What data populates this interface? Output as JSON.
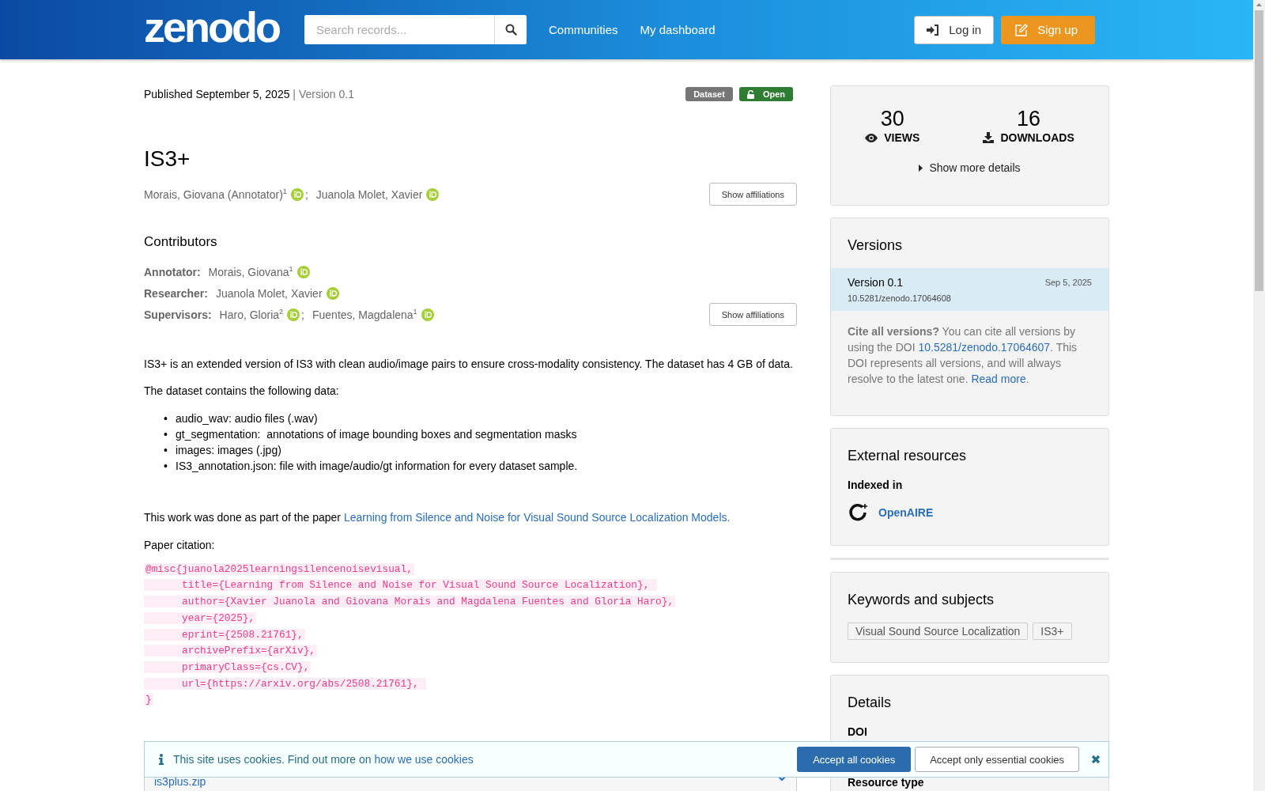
{
  "header": {
    "logo": "zenodo",
    "search": {
      "placeholder": "Search records..."
    },
    "nav": [
      "Communities",
      "My dashboard"
    ],
    "login": "Log in",
    "signup": "Sign up"
  },
  "record": {
    "published": "Published September 5, 2025",
    "separator": "|",
    "version": "Version 0.1",
    "badges": [
      {
        "label": "Dataset",
        "kind": "type"
      },
      {
        "label": "Open",
        "kind": "access"
      }
    ],
    "title": "IS3+",
    "creators": {
      "separator": ";",
      "items": [
        {
          "name": "Morais, Giovana (Annotator)",
          "sup": "1",
          "orcid": true
        },
        {
          "name": "Juanola Molet, Xavier",
          "orcid": true
        }
      ],
      "button": "Show affiliations"
    },
    "contributors": {
      "heading": "Contributors",
      "groups": [
        {
          "role": "Annotator:",
          "people": [
            {
              "name": "Morais, Giovana",
              "sup": "1",
              "orcid": true
            }
          ]
        },
        {
          "role": "Researcher:",
          "people": [
            {
              "name": "Juanola Molet, Xavier",
              "orcid": true
            }
          ]
        },
        {
          "role": "Supervisors:",
          "people": [
            {
              "name": "Haro, Gloria",
              "sup": "2",
              "orcid": true
            },
            {
              "name": "Fuentes, Magdalena",
              "sup": "1",
              "orcid": true
            }
          ]
        }
      ],
      "separator": ";",
      "button": "Show affiliations"
    },
    "description": [
      "IS3+ is an extended version of IS3 with clean audio/image pairs to ensure cross-modality consistency. The dataset has 4 GB of data.",
      "The dataset contains the following data:"
    ],
    "list_marker": "•",
    "list": [
      "audio_wav: audio files (.wav)",
      "gt_segmentation:  annotations of image bounding boxes and segmentation masks",
      "images: images (.jpg)",
      "IS3_annotation.json: file with image/audio/gt information for every dataset sample."
    ],
    "paper": {
      "text": "This work was done as part of the paper ",
      "link": "Learning from Silence and Noise for Visual Sound Source Localization Models."
    },
    "citation_label": "Paper citation:",
    "citation": [
      "@misc{juanola2025learningsilencenoisevisual,",
      "      title={Learning from Silence and Noise for Visual Sound Source Localization}, ",
      "      author={Xavier Juanola and Giovana Morais and Magdalena Fuentes and Gloria Haro},",
      "      year={2025},",
      "      eprint={2508.21761},",
      "      archivePrefix={arXiv},",
      "      primaryClass={cs.CV},",
      "      url={https://arxiv.org/abs/2508.21761}, ",
      "}"
    ],
    "files": [
      {
        "name": "is3plus.zip"
      }
    ]
  },
  "sidebar": {
    "stats": [
      {
        "value": "30",
        "label": "VIEWS",
        "kind": "views"
      },
      {
        "value": "16",
        "label": "DOWNLOADS",
        "kind": "downloads"
      }
    ],
    "more": "Show more details",
    "versions": {
      "title": "Versions",
      "items": [
        {
          "title": "Version 0.1",
          "date": "Sep 5, 2025",
          "doi": "10.5281/zenodo.17064608",
          "selected": true
        }
      ],
      "cite": [
        {
          "kind": "bold",
          "text": "Cite all versions?"
        },
        {
          "kind": "text",
          "text": " You can cite all versions by using the DOI "
        },
        {
          "kind": "link",
          "text": "10.5281/zenodo.17064607"
        },
        {
          "kind": "text",
          "text": ". This DOI represents all versions, and will always resolve to the latest one. "
        },
        {
          "kind": "link",
          "text": "Read more"
        },
        {
          "kind": "text",
          "text": "."
        }
      ]
    },
    "external": {
      "title": "External resources",
      "subtitle": "Indexed in",
      "items": [
        {
          "name": "OpenAIRE"
        }
      ]
    },
    "keywords": {
      "title": "Keywords and subjects",
      "tags": [
        "Visual Sound Source Localization",
        "IS3+"
      ]
    },
    "details": {
      "title": "Details",
      "fields": [
        "DOI",
        "Resource type"
      ]
    }
  },
  "cookies": {
    "text": "This site uses cookies. Find out more on ",
    "link": "how we use cookies",
    "accept_all": "Accept all cookies",
    "accept_essential": "Accept only essential cookies"
  }
}
